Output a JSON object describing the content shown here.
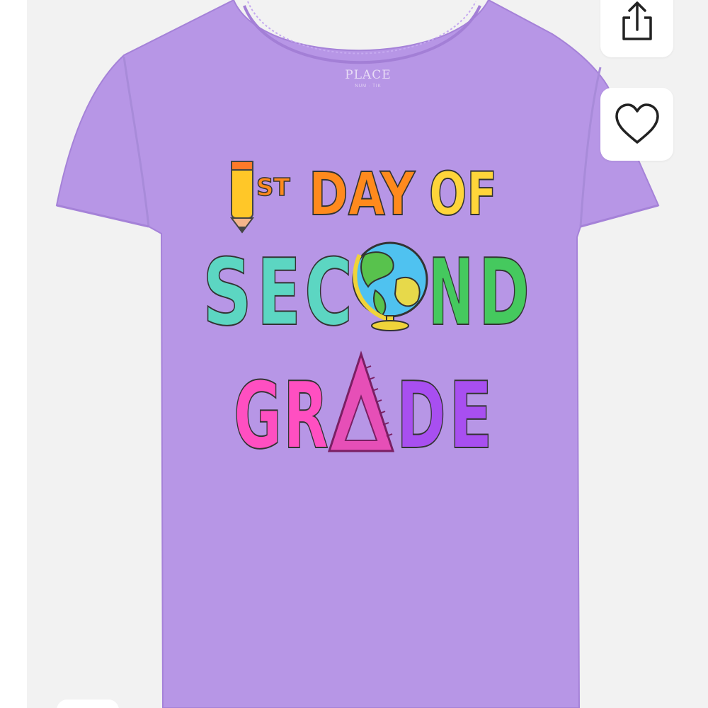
{
  "product_image": {
    "brand_tag": "PLACE",
    "brand_tag_sub": "NUM · TIK",
    "print_text": {
      "line1_number": "1",
      "line1_suffix": "ST",
      "line1_day": "DAY",
      "line1_of": "OF",
      "line2": [
        "S",
        "E",
        "C",
        "N",
        "D"
      ],
      "line3": [
        "G",
        "R",
        "D",
        "E"
      ]
    },
    "shirt_color": "#b796e6"
  },
  "actions": {
    "share_icon": "share-icon",
    "favorite_icon": "heart-icon"
  },
  "colors": {
    "orange": "#ff8a1d",
    "yellow": "#ffd53a",
    "teal": "#5cd6c2",
    "green": "#45c95e",
    "pink": "#ff4fc1",
    "purple": "#a84ff0"
  }
}
